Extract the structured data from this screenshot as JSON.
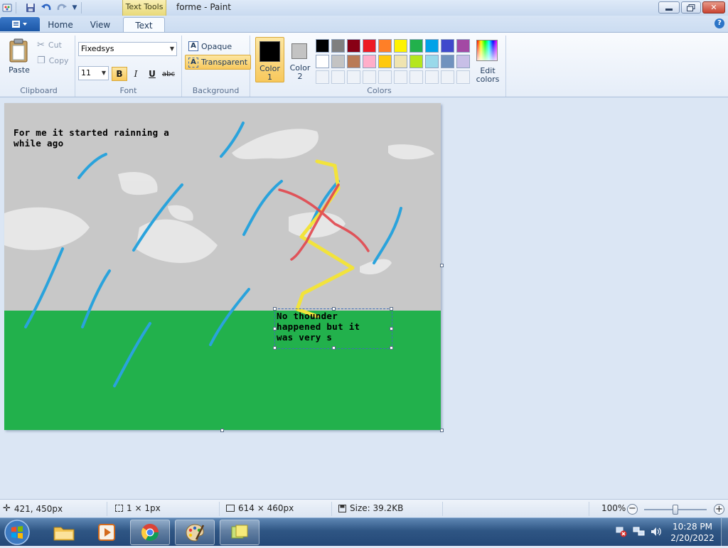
{
  "window": {
    "title": "forme - Paint",
    "contextual_tab": "Text Tools"
  },
  "tabs": {
    "file_icon": "file-menu-icon",
    "home": "Home",
    "view": "View",
    "text": "Text"
  },
  "clipboard": {
    "paste": "Paste",
    "cut": "Cut",
    "copy": "Copy",
    "group_label": "Clipboard"
  },
  "font": {
    "family": "Fixedsys",
    "size": "11",
    "bold": "B",
    "italic": "I",
    "underline": "U",
    "strike": "abc",
    "group_label": "Font"
  },
  "background": {
    "opaque": "Opaque",
    "transparent": "Transparent",
    "group_label": "Background"
  },
  "colors": {
    "color1_label_1": "Color",
    "color1_label_2": "1",
    "color2_label_1": "Color",
    "color2_label_2": "2",
    "edit_1": "Edit",
    "edit_2": "colors",
    "group_label": "Colors",
    "color1_value": "#000000",
    "color2_value": "#c3c3c3",
    "palette_row1": [
      "#000000",
      "#7f7f7f",
      "#880015",
      "#ed1c24",
      "#ff7f27",
      "#fff200",
      "#22b14c",
      "#00a2e8",
      "#3f48cc",
      "#a349a4"
    ],
    "palette_row2": [
      "#ffffff",
      "#c3c3c3",
      "#b97a57",
      "#ffaec9",
      "#ffc90e",
      "#efe4b0",
      "#b5e61d",
      "#99d9ea",
      "#7092be",
      "#c8bfe7"
    ]
  },
  "canvas": {
    "text1_line1": "For me it started rainning a",
    "text1_line2": "while ago",
    "text2_line1": "No thounder",
    "text2_line2": "happened but it",
    "text2_line3": "was very s",
    "sky_color": "#c8c8c8",
    "grass_color": "#22b14c",
    "rain_color": "#2aa3dc",
    "bolt_color": "#f2e33c",
    "cross_color": "#e2474e"
  },
  "status": {
    "cursor_pos": "421, 450px",
    "selection_size": "1 × 1px",
    "image_size": "614 × 460px",
    "file_size": "Size: 39.2KB",
    "zoom": "100%"
  },
  "taskbar": {
    "time": "10:28 PM",
    "date": "2/20/2022"
  }
}
